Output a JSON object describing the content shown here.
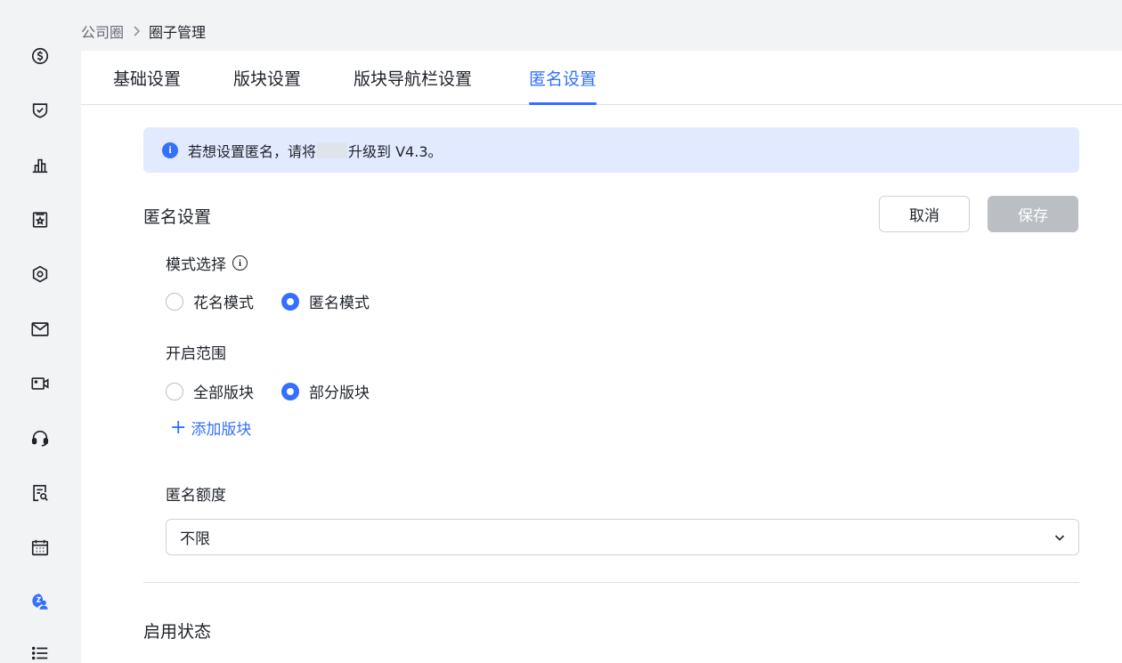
{
  "breadcrumb": {
    "root": "公司圈",
    "current": "圈子管理"
  },
  "sidebar": {
    "icons": [
      "dollar-circle-icon",
      "shield-check-icon",
      "bar-chart-icon",
      "star-badge-icon",
      "hexagon-settings-icon",
      "mail-icon",
      "video-camera-icon",
      "headset-icon",
      "document-search-icon",
      "calendar-icon",
      "people-circle-icon",
      "list-icon"
    ],
    "active": "people-circle-icon"
  },
  "tabs": [
    {
      "label": "基础设置"
    },
    {
      "label": "版块设置"
    },
    {
      "label": "版块导航栏设置"
    },
    {
      "label": "匿名设置",
      "active": true
    }
  ],
  "alert": {
    "text_before": "若想设置匿名，请将",
    "text_after": "升级到 V4.3。"
  },
  "section": {
    "title": "匿名设置",
    "cancel_label": "取消",
    "save_label": "保存"
  },
  "mode": {
    "label": "模式选择",
    "options": [
      {
        "label": "花名模式",
        "checked": false
      },
      {
        "label": "匿名模式",
        "checked": true
      }
    ]
  },
  "scope": {
    "label": "开启范围",
    "options": [
      {
        "label": "全部版块",
        "checked": false
      },
      {
        "label": "部分版块",
        "checked": true
      }
    ],
    "add_label": "添加版块"
  },
  "quota": {
    "label": "匿名额度",
    "value": "不限"
  },
  "status": {
    "title": "启用状态"
  },
  "colors": {
    "accent": "#3370ff",
    "alert_bg": "#e1eaff",
    "disabled": "#bbbfc4"
  }
}
